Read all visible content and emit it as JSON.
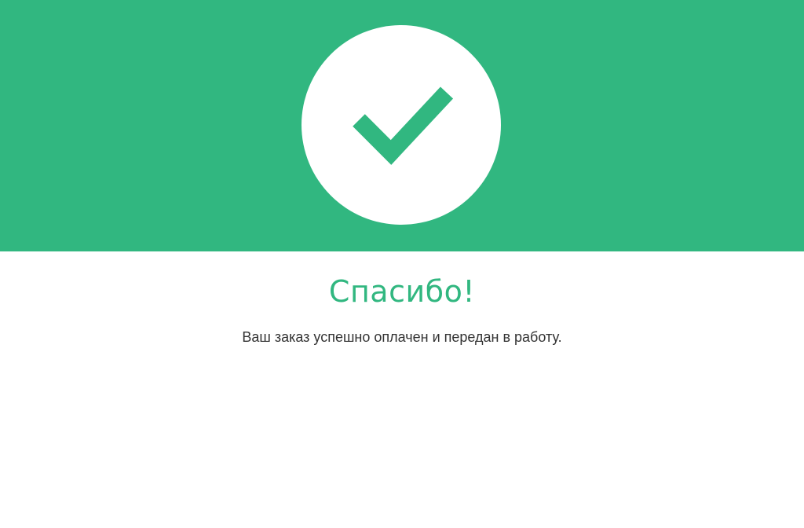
{
  "banner": {
    "color": "#31b780",
    "icon": "checkmark-icon"
  },
  "content": {
    "title": "Спасибо!",
    "message": "Ваш заказ успешно оплачен и передан в работу."
  }
}
